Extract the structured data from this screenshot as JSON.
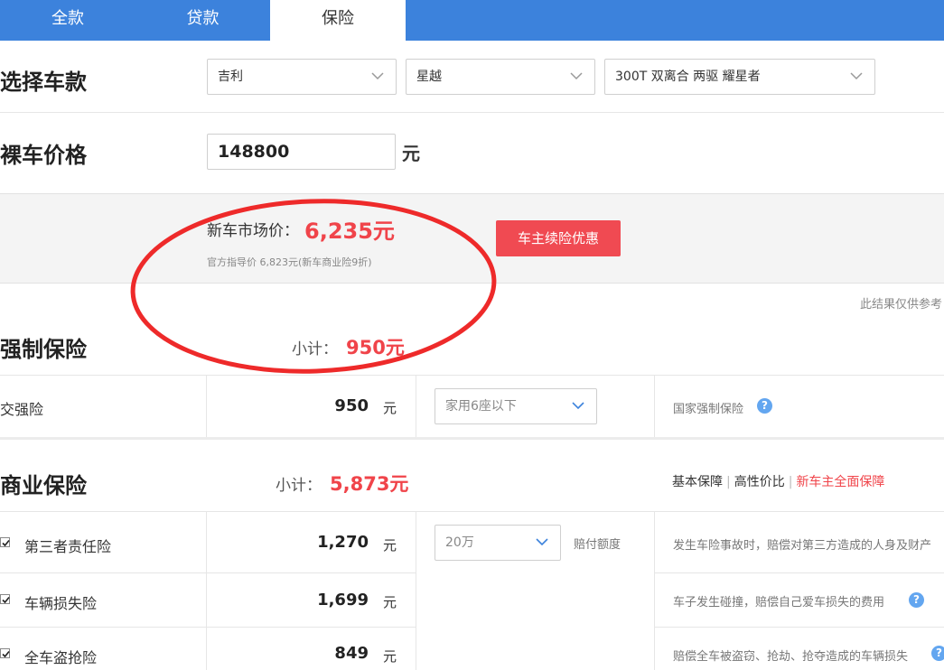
{
  "tabs": [
    {
      "label": "全款",
      "active": false
    },
    {
      "label": "贷款",
      "active": false
    },
    {
      "label": "保险",
      "active": true
    }
  ],
  "select_car": {
    "title": "选择车款",
    "brand": "吉利",
    "series": "星越",
    "model": "300T 双离合 两驱 耀星者"
  },
  "bare_price": {
    "title": "裸车价格",
    "value": "148800",
    "unit": "元"
  },
  "market": {
    "label": "新车市场价：",
    "value": "6,235元",
    "sub": "官方指导价 6,823元(新车商业险9折)",
    "renew_button": "车主续险优惠",
    "note": "此结果仅供参考"
  },
  "compulsory": {
    "title": "强制保险",
    "subtotal_label": "小计：",
    "subtotal_value": "950元",
    "rows": [
      {
        "name": "交强险",
        "amount": "950",
        "unit": "元",
        "option": "家用6座以下",
        "desc": "国家强制保险"
      }
    ]
  },
  "commercial": {
    "title": "商业保险",
    "subtotal_label": "小计：",
    "subtotal_value": "5,873元",
    "plans": [
      "基本保障",
      "高性价比",
      "新车主全面保障"
    ],
    "rows": [
      {
        "name": "第三者责任险",
        "amount": "1,270",
        "unit": "元",
        "option": "20万",
        "option_label": "赔付额度",
        "desc": "发生车险事故时，赔偿对第三方造成的人身及财产",
        "checked": true
      },
      {
        "name": "车辆损失险",
        "amount": "1,699",
        "unit": "元",
        "desc": "车子发生碰撞，赔偿自己爱车损失的费用",
        "checked": true
      },
      {
        "name": "全车盗抢险",
        "amount": "849",
        "unit": "元",
        "desc": "赔偿全车被盗窃、抢劫、抢夺造成的车辆损失",
        "checked": true
      }
    ]
  },
  "colors": {
    "tab_bar": "#3c82dc",
    "accent_red": "#f0444a",
    "help_blue": "#63a6f0",
    "annotation_red": "#ee2a2a"
  }
}
